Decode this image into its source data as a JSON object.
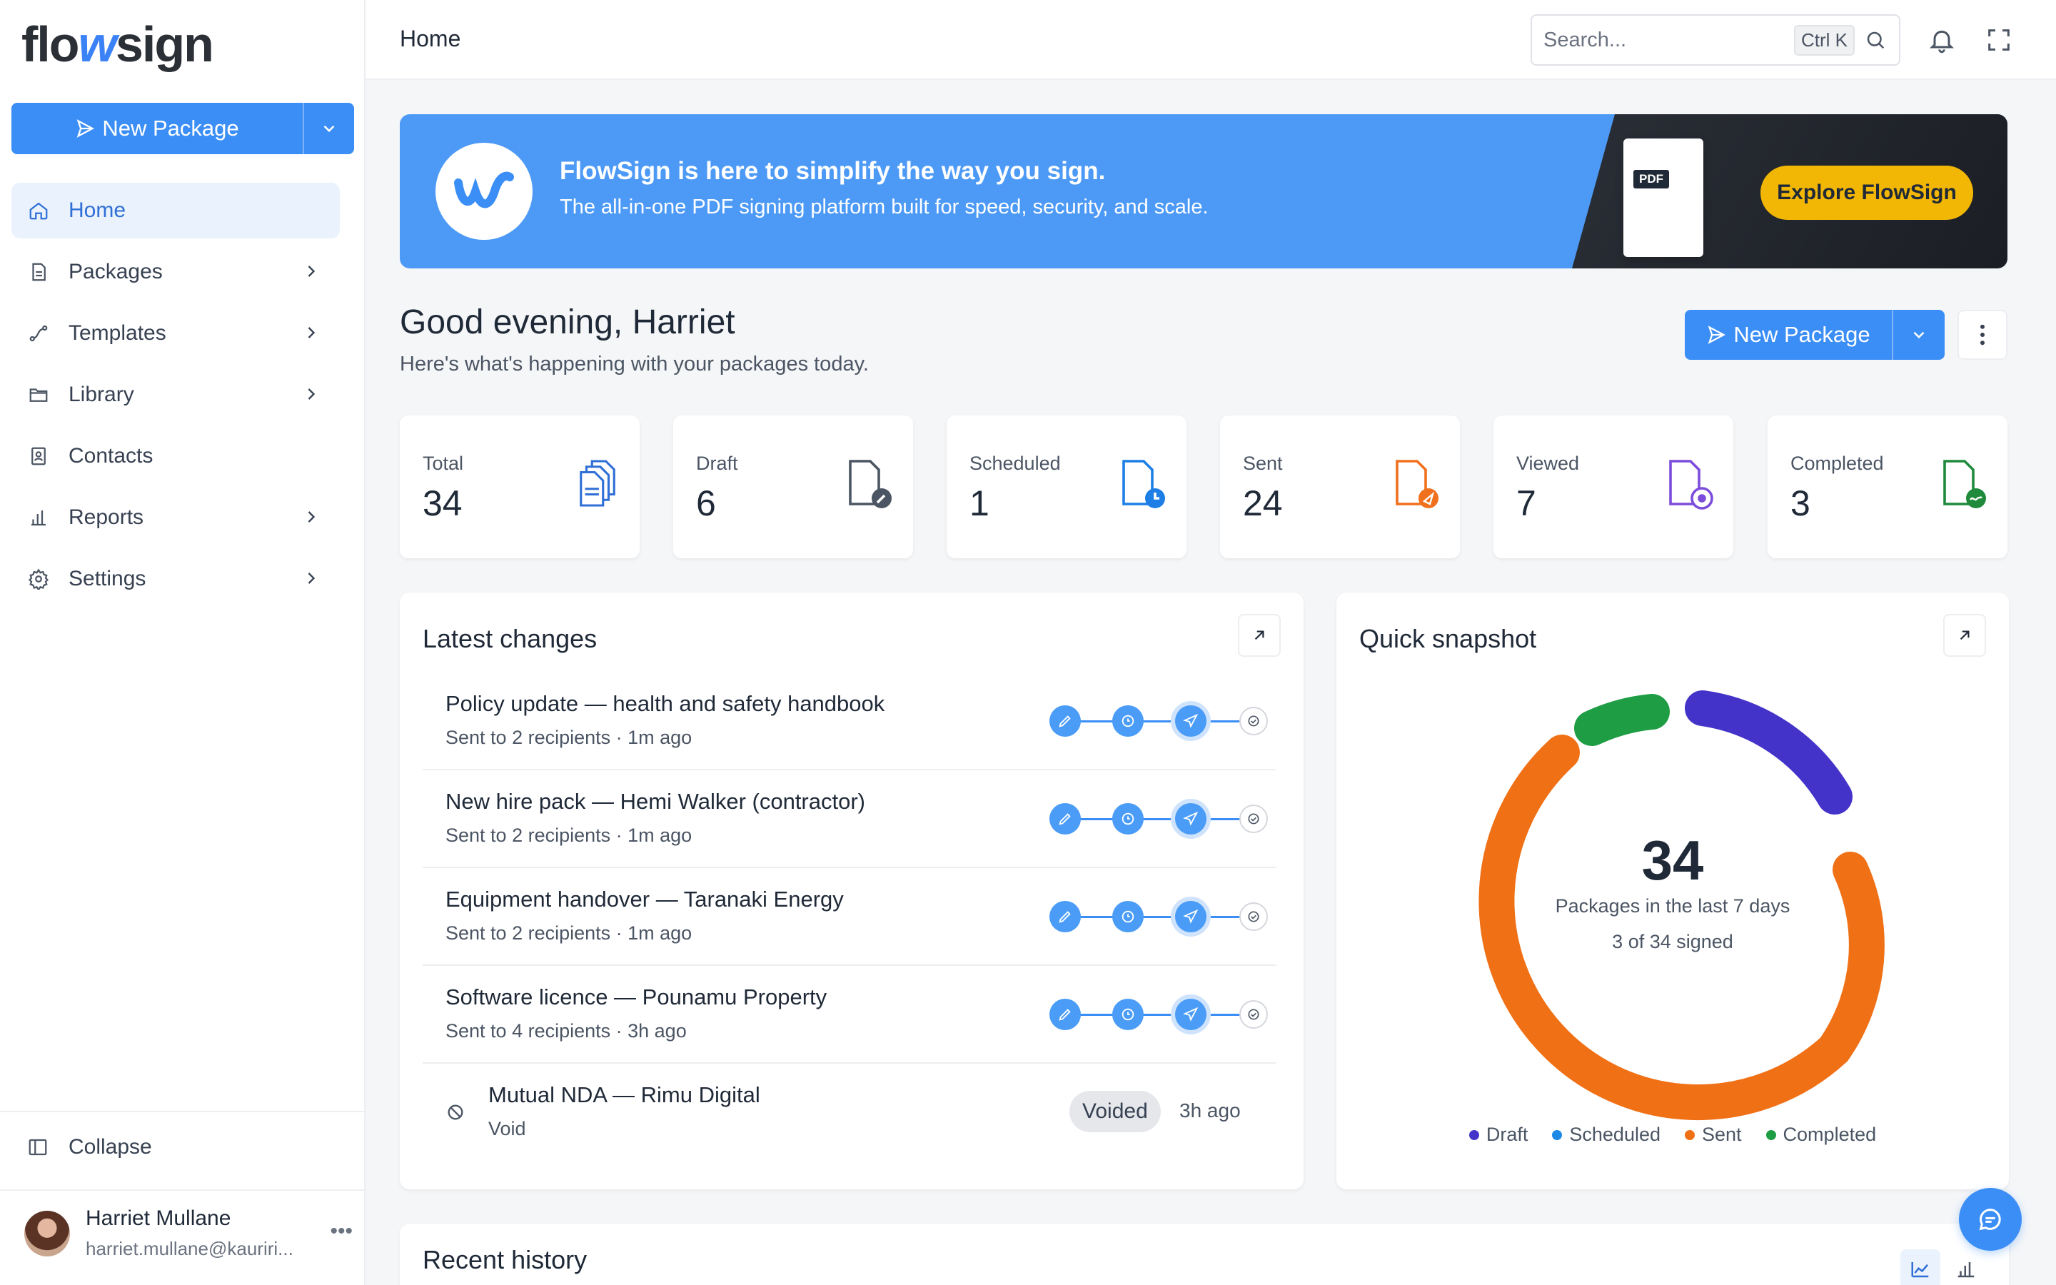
{
  "app": {
    "logo_prefix": "flo",
    "logo_mid": "w",
    "logo_suffix": "sign",
    "accent": "#3b8ef5"
  },
  "sidebar": {
    "new_package_label": "New Package",
    "items": [
      {
        "label": "Home",
        "icon": "home-icon",
        "active": true,
        "has_children": false
      },
      {
        "label": "Packages",
        "icon": "document-icon",
        "has_children": true
      },
      {
        "label": "Templates",
        "icon": "route-icon",
        "has_children": true
      },
      {
        "label": "Library",
        "icon": "folder-icon",
        "has_children": true
      },
      {
        "label": "Contacts",
        "icon": "contact-book-icon",
        "has_children": false
      },
      {
        "label": "Reports",
        "icon": "bar-chart-icon",
        "has_children": true
      },
      {
        "label": "Settings",
        "icon": "gear-icon",
        "has_children": true
      }
    ],
    "collapse_label": "Collapse",
    "user": {
      "name": "Harriet Mullane",
      "email": "harriet.mullane@kauriri..."
    }
  },
  "topbar": {
    "breadcrumb": "Home",
    "search_placeholder": "Search...",
    "search_shortcut": "Ctrl K"
  },
  "banner": {
    "title": "FlowSign is here to simplify the way you sign.",
    "subtitle": "The all-in-one PDF signing platform built for speed, security, and scale.",
    "pdf_tag": "PDF",
    "cta": "Explore FlowSign"
  },
  "greeting": {
    "title": "Good evening, Harriet",
    "subtitle": "Here's what's happening with your packages today.",
    "new_package_label": "New Package"
  },
  "stats": [
    {
      "label": "Total",
      "value": "34",
      "icon": "documents-icon",
      "color": "#2f6fd6"
    },
    {
      "label": "Draft",
      "value": "6",
      "icon": "draft-edit-icon",
      "color": "#4b5563"
    },
    {
      "label": "Scheduled",
      "value": "1",
      "icon": "scheduled-clock-icon",
      "color": "#1d7fe6"
    },
    {
      "label": "Sent",
      "value": "24",
      "icon": "sent-icon",
      "color": "#f0701d"
    },
    {
      "label": "Viewed",
      "value": "7",
      "icon": "viewed-eye-icon",
      "color": "#7c4ddb"
    },
    {
      "label": "Completed",
      "value": "3",
      "icon": "completed-sign-icon",
      "color": "#1f8a3c"
    }
  ],
  "latest": {
    "title": "Latest changes",
    "rows": [
      {
        "title": "Policy update — health and safety handbook",
        "subtitle": "Sent to 2 recipients · 1m ago"
      },
      {
        "title": "New hire pack — Hemi Walker (contractor)",
        "subtitle": "Sent to 2 recipients · 1m ago"
      },
      {
        "title": "Equipment handover — Taranaki Energy",
        "subtitle": "Sent to 2 recipients · 1m ago"
      },
      {
        "title": "Software licence — Pounamu Property",
        "subtitle": "Sent to 4 recipients · 3h ago"
      }
    ],
    "void_row": {
      "title": "Mutual NDA — Rimu Digital",
      "subtitle": "Void",
      "badge": "Voided",
      "time": "3h ago"
    }
  },
  "snapshot": {
    "title": "Quick snapshot",
    "total": "34",
    "line1": "Packages in the last 7 days",
    "line2": "3 of 34 signed",
    "legend": [
      {
        "label": "Draft",
        "color": "#4433c9"
      },
      {
        "label": "Scheduled",
        "color": "#1e88e5"
      },
      {
        "label": "Sent",
        "color": "#f07016"
      },
      {
        "label": "Completed",
        "color": "#1f9d45"
      }
    ]
  },
  "history": {
    "title": "Recent history"
  }
}
